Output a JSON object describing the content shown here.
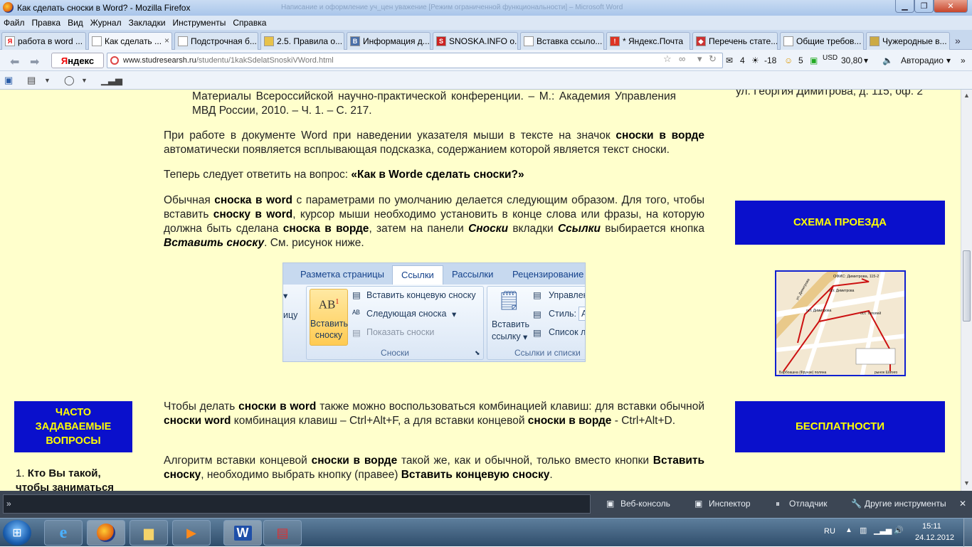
{
  "window": {
    "title": "Как сделать сноски в Word? - Mozilla Firefox",
    "ghost_title": "Написание и оформление уч_цен уважение [Режим ограниченной функциональности] – Microsoft Word"
  },
  "menu": [
    "Файл",
    "Правка",
    "Вид",
    "Журнал",
    "Закладки",
    "Инструменты",
    "Справка"
  ],
  "tabs": [
    {
      "label": "работа в word ...",
      "fav": "Я",
      "color": "#ffffff"
    },
    {
      "label": "Как сделать ...",
      "fav": "",
      "color": "#ffffff"
    },
    {
      "label": "Подстрочная б...",
      "fav": "",
      "color": "#ffffff"
    },
    {
      "label": "2.5. Правила о...",
      "fav": "",
      "color": "#e8c24a"
    },
    {
      "label": "Информация д...",
      "fav": "В",
      "color": "#4a6fa8"
    },
    {
      "label": "SNOSKA.INFO о...",
      "fav": "S",
      "color": "#cc2222"
    },
    {
      "label": "Вставка ссыло...",
      "fav": "",
      "color": "#ffffff"
    },
    {
      "label": "* Яндекс.Почта",
      "fav": "!",
      "color": "#dd3322"
    },
    {
      "label": "Перечень стате...",
      "fav": "◆",
      "color": "#cc3333"
    },
    {
      "label": "Общие требов...",
      "fav": "",
      "color": "#ffffff"
    },
    {
      "label": "Чужеродные в...",
      "fav": "",
      "color": "#ccaa44"
    }
  ],
  "nav": {
    "yandex_first": "Я",
    "yandex_rest": "ндекс",
    "url_domain": "www.studresearsh.ru",
    "url_path": "/studentu/1kakSdelatSnoskiVWord.html",
    "mail_count": "4",
    "temp": "-18",
    "traffic": "5",
    "usd_label": "USD",
    "usd_value": "30,80",
    "radio": "Авторадио"
  },
  "article": {
    "p0": "Материалы Всероссийской научно-практической конференции. – М.: Академия Управления МВД России, 2010. – Ч. 1. – С. 217.",
    "p1_a": "При работе в документе Word при наведении указателя мыши в тексте на значок ",
    "p1_b": "сноски в ворде",
    "p1_c": " автоматически появляется всплывающая подсказка, содержанием которой является текст сноски.",
    "p2_a": "Теперь следует ответить на вопрос: ",
    "p2_b": "«Как в Worde сделать сноски?»",
    "p3_a": "Обычная ",
    "p3_b": "сноска в word",
    "p3_c": " с параметрами по умолчанию делается следующим образом. Для того, чтобы вставить ",
    "p3_d": "сноску в word",
    "p3_e": ", курсор мыши необходимо установить в конце слова или фразы, на которую должна быть сделана ",
    "p3_f": "сноска в ворде",
    "p3_g": ", затем на панели ",
    "p3_h": "Сноски",
    "p3_i": " вкладки ",
    "p3_j": "Ссылки",
    "p3_k": " выбирается кнопка ",
    "p3_l": "Вставить сноску",
    "p3_m": ". См. рисунок ниже.",
    "p4_a": "Чтобы делать ",
    "p4_b": "сноски в word",
    "p4_c": " также можно воспользоваться комбинацией клавиш: для вставки обычной ",
    "p4_d": "сноски word",
    "p4_e": " комбинация клавиш – Ctrl+Alt+F, а для вставки концевой ",
    "p4_f": "сноски в ворде",
    "p4_g": " - Ctrl+Alt+D.",
    "p5_a": "Алгоритм вставки концевой ",
    "p5_b": "сноски в ворде",
    "p5_c": " такой же, как и обычной, только вместо кнопки ",
    "p5_d": "Вставить сноску",
    "p5_e": ", необходимо выбрать кнопку (правее) ",
    "p5_f": "Вставить концевую сноску",
    "p5_g": "."
  },
  "ribbon": {
    "tab_layout": "Разметка страницы",
    "tab_refs": "Ссылки",
    "tab_mail": "Рассылки",
    "tab_review": "Рецензирование",
    "left_partial": "ицу",
    "ab_label": "AB",
    "ab_sup": "1",
    "insert_footnote_1": "Вставить",
    "insert_footnote_2": "сноску",
    "insert_endnote": "Вставить концевую сноску",
    "next_footnote": "Следующая сноска",
    "show_notes": "Показать сноски",
    "group_notes": "Сноски",
    "insert_cite_1": "Вставить",
    "insert_cite_2": "ссылку",
    "manage": "Управлен",
    "style": "Стиль:",
    "style_val": "A",
    "biblio": "Список л",
    "group_cites": "Ссылки и списки"
  },
  "right": {
    "address": "ул. Георгия Димитрова, д. 115, оф. 2",
    "scheme": "СХЕМА ПРОЕЗДА",
    "free": "БЕСПЛАТНОСТИ"
  },
  "map": {
    "office": "ОФИС: Димитрова, 115-2",
    "stop1": "ост. Димитрова",
    "stop2": "ост. Димитрова",
    "stop3": "ост. Тополей",
    "street": "ул. Димитрова",
    "market1": "Барбоашна (Фрунзе) поляна",
    "market2": "рынок Шатиго"
  },
  "left": {
    "faq": "ЧАСТО ЗАДАВАЕМЫЕ ВОПРОСЫ",
    "q1_num": "1.",
    "q1_text": "Кто Вы такой, чтобы заниматься"
  },
  "devtools": {
    "prompt": "»",
    "console": "Веб-консоль",
    "inspector": "Инспектор",
    "debugger": "Отладчик",
    "other": "Другие инструменты"
  },
  "tray": {
    "lang": "RU",
    "time": "15:11",
    "date": "24.12.2012"
  }
}
